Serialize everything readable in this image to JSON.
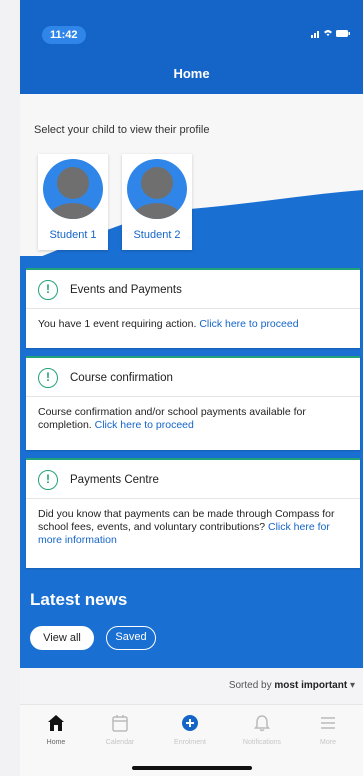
{
  "status_bar": {
    "time": "11:42",
    "icons": "… ▲ ▬"
  },
  "header": {
    "title": "Home"
  },
  "profile": {
    "prompt": "Select your child to view their profile",
    "students": [
      {
        "name": "Student 1"
      },
      {
        "name": "Student 2"
      }
    ]
  },
  "cards": [
    {
      "title": "Events and Payments",
      "body": "You have 1 event requiring action.",
      "link": "Click here to proceed"
    },
    {
      "title": "Course confirmation",
      "body": "Course confirmation and/or school payments available for completion.",
      "link": "Click here to proceed"
    },
    {
      "title": "Payments Centre",
      "body": "Did you know that payments can be made through Compass for school fees, events, and voluntary contributions?",
      "link": "Click here for more information"
    }
  ],
  "news": {
    "title": "Latest news",
    "filters": [
      {
        "label": "View all",
        "selected": true
      },
      {
        "label": "Saved",
        "selected": false
      }
    ]
  },
  "sort": {
    "prefix": "Sorted by",
    "value": "most important",
    "arrow": "▾"
  },
  "tabs": [
    {
      "label": "Home",
      "icon": "home-icon",
      "active": true
    },
    {
      "label": "Calendar",
      "icon": "calendar-icon",
      "active": false
    },
    {
      "label": "Enrolment",
      "icon": "plus-circle-icon",
      "active": false
    },
    {
      "label": "Notifications",
      "icon": "bell-icon",
      "active": false
    },
    {
      "label": "More",
      "icon": "menu-icon",
      "active": false
    }
  ],
  "colors": {
    "brand": "#1565c8",
    "accent": "#22a27a",
    "avatar": "#2f86e8"
  }
}
